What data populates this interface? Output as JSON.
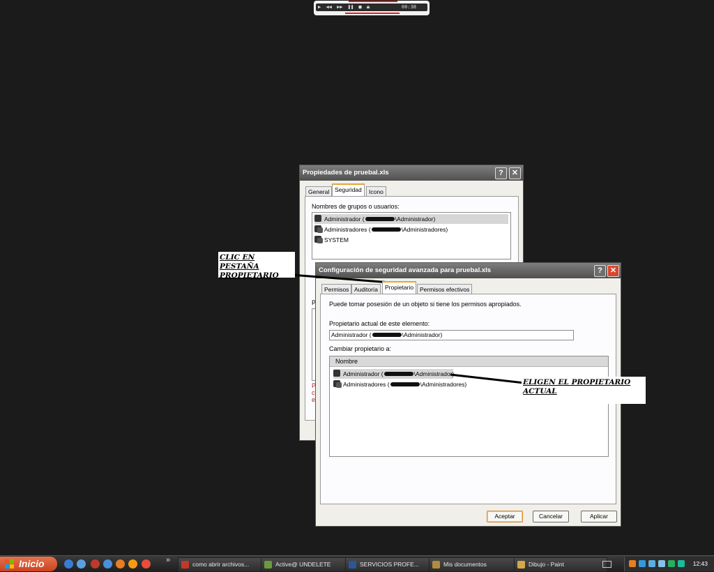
{
  "media_player": {
    "time": "00:38"
  },
  "props_window": {
    "title": "Propiedades de pruebal.xls",
    "help": "?",
    "close": "✕",
    "tabs": [
      "General",
      "Seguridad",
      "Icono"
    ],
    "groups_label": "Nombres de grupos o usuarios:",
    "users": [
      {
        "prefix": "Administrador (",
        "suffix": "\\Administrador)"
      },
      {
        "prefix": "Administradores (",
        "suffix": "\\Administradores)"
      },
      {
        "prefix": "SYSTEM",
        "suffix": ""
      }
    ],
    "partial_letters": [
      "P",
      "P",
      "c",
      "e"
    ]
  },
  "adv_window": {
    "title": "Configuración de seguridad avanzada para pruebal.xls",
    "help": "?",
    "close": "✕",
    "tabs": [
      "Permisos",
      "Auditoría",
      "Propietario",
      "Permisos efectivos"
    ],
    "intro": "Puede tomar posesión de un objeto si tiene los permisos apropiados.",
    "current_owner_label": "Propietario actual de este elemento:",
    "current_owner": {
      "prefix": "Administrador (",
      "suffix": "\\Administrador)"
    },
    "change_label": "Cambiar propietario a:",
    "column_header": "Nombre",
    "owners": [
      {
        "prefix": "Administrador (",
        "suffix": "\\Administrador)"
      },
      {
        "prefix": "Administradores (",
        "suffix": "\\Administradores)"
      }
    ],
    "buttons": {
      "ok": "Aceptar",
      "cancel": "Cancelar",
      "apply": "Aplicar"
    }
  },
  "annotations": {
    "tab_hint": [
      "CLIC EN PESTAÑA",
      "PROPIETARIO"
    ],
    "owner_hint": [
      "ELIGEN EL PROPIETARIO",
      "ACTUAL"
    ]
  },
  "taskbar": {
    "start": "Inicio",
    "chevron": "»",
    "tasks": [
      {
        "label": "como abrir archivos..."
      },
      {
        "label": "Active@ UNDELETE"
      },
      {
        "label": "SERVICIOS PROFE..."
      },
      {
        "label": "Mis documentos"
      },
      {
        "label": "Dibujo - Paint"
      }
    ],
    "clock": "12:43"
  }
}
